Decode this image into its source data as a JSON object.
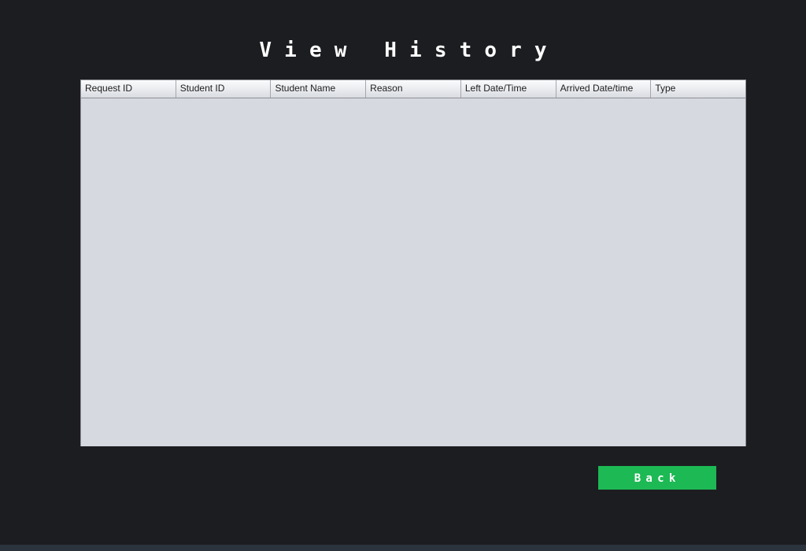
{
  "page": {
    "title": "View History"
  },
  "table": {
    "columns": [
      "Request ID",
      "Student ID",
      "Student Name",
      "Reason",
      "Left Date/Time",
      "Arrived Date/time",
      "Type"
    ],
    "rows": []
  },
  "actions": {
    "back_label": "Back"
  },
  "colors": {
    "background": "#1c1d21",
    "table_body": "#d6d9e0",
    "back_button": "#1db954",
    "title_text": "#ffffff"
  }
}
